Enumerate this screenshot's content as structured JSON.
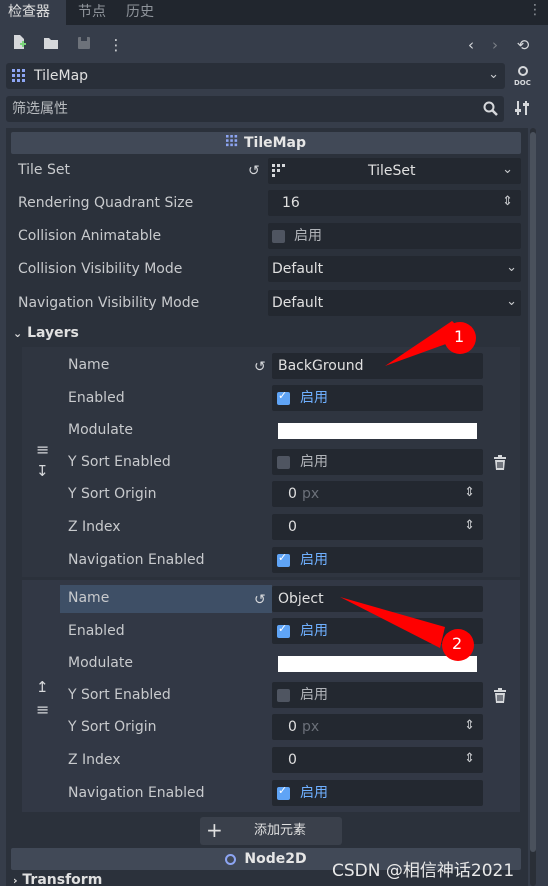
{
  "tabs": [
    "检查器",
    "节点",
    "历史"
  ],
  "object_selector": {
    "label": "TileMap"
  },
  "filter": {
    "placeholder": "筛选属性"
  },
  "section": {
    "title": "TileMap"
  },
  "props": {
    "tile_set": {
      "label": "Tile Set",
      "value": "TileSet"
    },
    "rqs": {
      "label": "Rendering Quadrant Size",
      "value": "16"
    },
    "collision_animatable": {
      "label": "Collision Animatable",
      "value": "启用"
    },
    "collision_vis": {
      "label": "Collision Visibility Mode",
      "value": "Default"
    },
    "nav_vis": {
      "label": "Navigation Visibility Mode",
      "value": "Default"
    }
  },
  "layers_title": "Layers",
  "layer_labels": {
    "name": "Name",
    "enabled": "Enabled",
    "modulate": "Modulate",
    "ysort_enabled": "Y Sort Enabled",
    "ysort_origin": "Y Sort Origin",
    "z_index": "Z Index",
    "nav_enabled": "Navigation Enabled"
  },
  "layers": [
    {
      "name": "BackGround",
      "enabled": "启用",
      "ysort": "启用",
      "ysort_origin": "0",
      "unit": "px",
      "z_index": "0",
      "nav": "启用"
    },
    {
      "name": "Object",
      "enabled": "启用",
      "ysort": "启用",
      "ysort_origin": "0",
      "unit": "px",
      "z_index": "0",
      "nav": "启用"
    }
  ],
  "annotations": [
    "1",
    "2"
  ],
  "add_button": "添加元素",
  "node2d": "Node2D",
  "transform": "Transform",
  "watermark": "CSDN @相信神话2021",
  "colors": {
    "accent": "#5fa4f6",
    "annotation": "#ff0000"
  }
}
